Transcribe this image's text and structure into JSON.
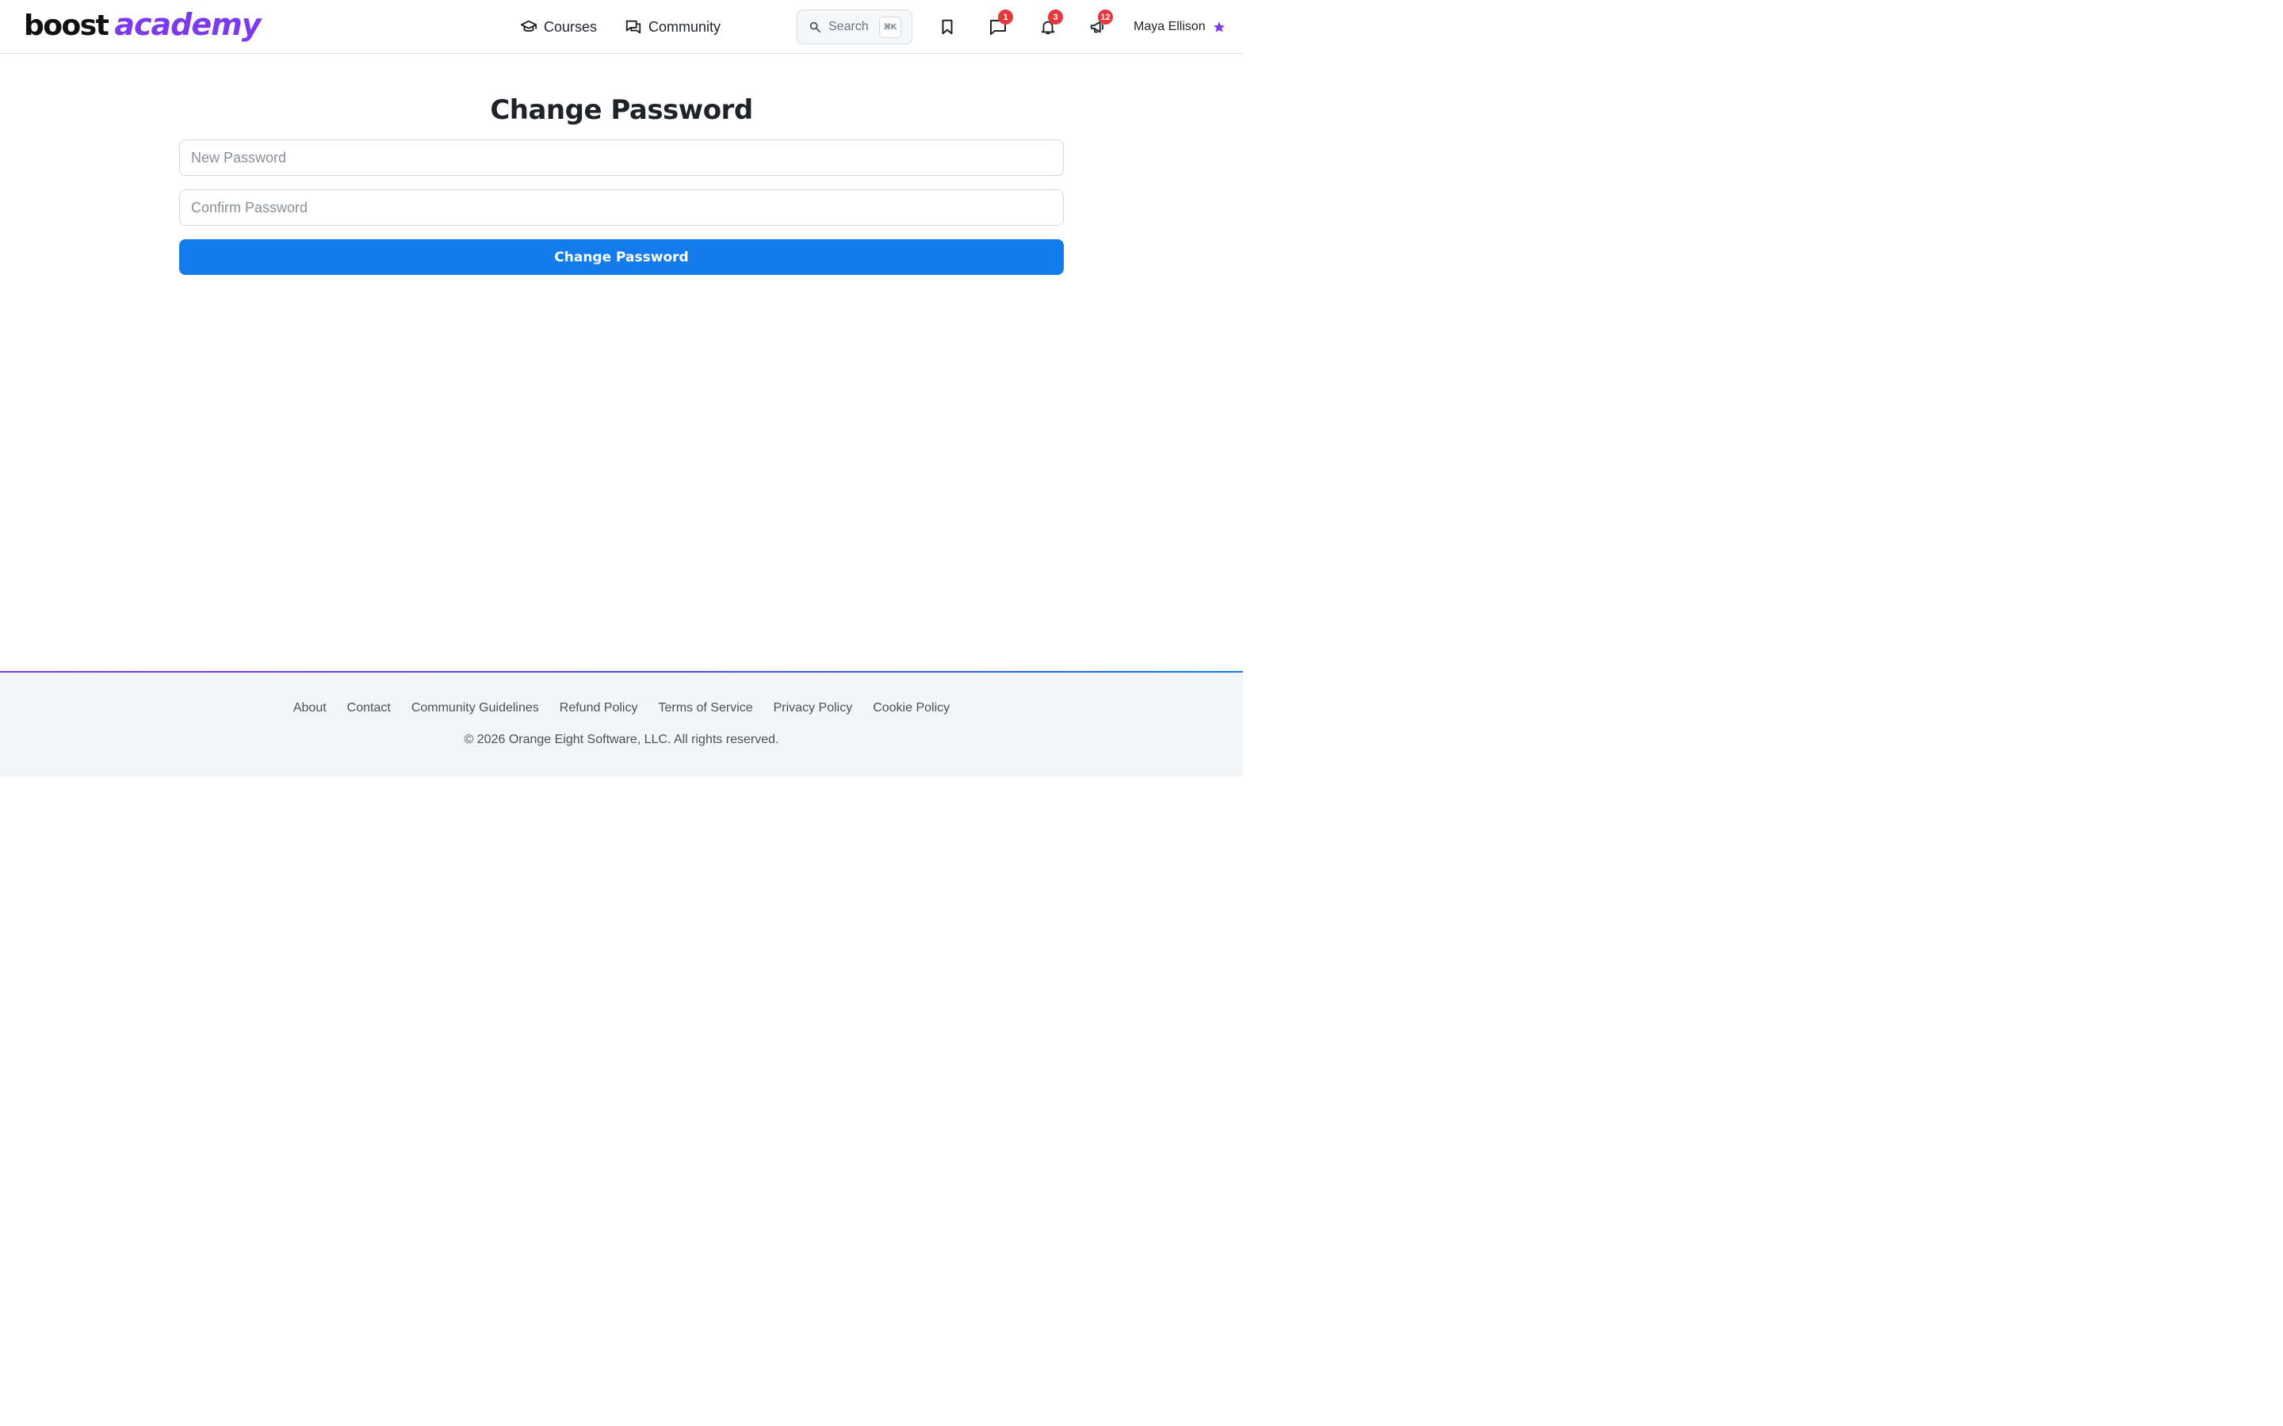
{
  "brand": {
    "part1": "boost",
    "part2": "academy",
    "accent_color": "#7c3aed"
  },
  "nav": {
    "courses": {
      "label": "Courses",
      "icon": "graduation-cap-icon"
    },
    "community": {
      "label": "Community",
      "icon": "chat-bubbles-icon"
    }
  },
  "search": {
    "placeholder": "Search",
    "shortcut": "⌘K",
    "icon": "search-icon"
  },
  "header_icons": {
    "bookmark": {
      "icon": "bookmark-icon"
    },
    "messages": {
      "icon": "message-icon",
      "badge": "1"
    },
    "notifications": {
      "icon": "bell-icon",
      "badge": "3"
    },
    "announcements": {
      "icon": "megaphone-icon",
      "badge": "12"
    },
    "badge_color": "#e5383b"
  },
  "user": {
    "name": "Maya Ellison",
    "icon": "star-icon"
  },
  "main": {
    "title": "Change Password",
    "new_password_placeholder": "New Password",
    "confirm_password_placeholder": "Confirm Password",
    "submit_label": "Change Password",
    "button_color": "#137bea"
  },
  "footer": {
    "links": [
      "About",
      "Contact",
      "Community Guidelines",
      "Refund Policy",
      "Terms of Service",
      "Privacy Policy",
      "Cookie Policy"
    ],
    "copyright": "© 2026 Orange Eight Software, LLC. All rights reserved."
  }
}
